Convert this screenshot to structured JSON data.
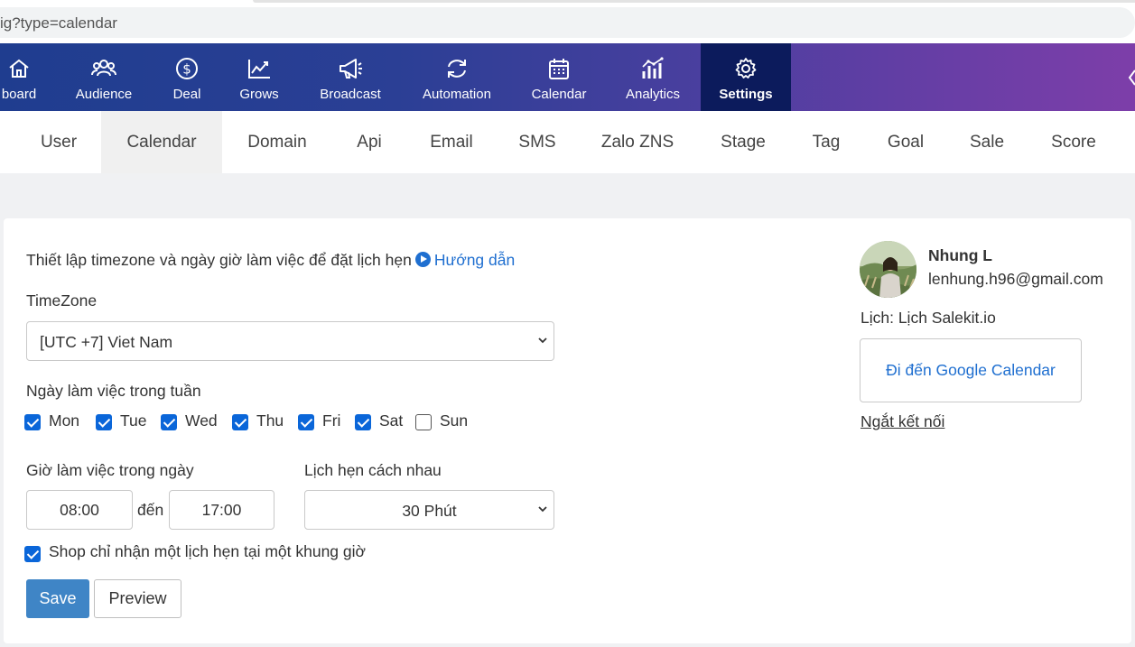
{
  "browser": {
    "url": "ig?type=calendar"
  },
  "topnav": {
    "items": [
      {
        "label": "board",
        "icon": "home-icon"
      },
      {
        "label": "Audience",
        "icon": "users-icon"
      },
      {
        "label": "Deal",
        "icon": "dollar-icon"
      },
      {
        "label": "Grows",
        "icon": "trend-icon"
      },
      {
        "label": "Broadcast",
        "icon": "megaphone-icon"
      },
      {
        "label": "Automation",
        "icon": "refresh-icon"
      },
      {
        "label": "Calendar",
        "icon": "calendar-icon"
      },
      {
        "label": "Analytics",
        "icon": "analytics-icon"
      },
      {
        "label": "Settings",
        "icon": "gear-icon"
      }
    ],
    "active": "Settings"
  },
  "subtabs": {
    "items": [
      "User",
      "Calendar",
      "Domain",
      "Api",
      "Email",
      "SMS",
      "Zalo ZNS",
      "Stage",
      "Tag",
      "Goal",
      "Sale",
      "Score"
    ],
    "active": "Calendar"
  },
  "form": {
    "intro": "Thiết lập timezone và ngày giờ làm việc để đặt lịch hẹn",
    "guide_link": "Hướng dẫn",
    "timezone_label": "TimeZone",
    "timezone_value": "[UTC +7] Viet Nam",
    "workdays_label": "Ngày làm việc trong tuần",
    "days": [
      {
        "label": "Mon",
        "checked": true
      },
      {
        "label": "Tue",
        "checked": true
      },
      {
        "label": "Wed",
        "checked": true
      },
      {
        "label": "Thu",
        "checked": true
      },
      {
        "label": "Fri",
        "checked": true
      },
      {
        "label": "Sat",
        "checked": true
      },
      {
        "label": "Sun",
        "checked": false
      }
    ],
    "hours_label": "Giờ làm việc trong ngày",
    "start_time": "08:00",
    "to_label": "đến",
    "end_time": "17:00",
    "interval_label": "Lịch hẹn cách nhau",
    "interval_value": "30 Phút",
    "single_slot_label": "Shop chỉ nhận một lịch hẹn tại một khung giờ",
    "single_slot_checked": true,
    "save_label": "Save",
    "preview_label": "Preview"
  },
  "account": {
    "name": "Nhung L",
    "email": "lenhung.h96@gmail.com",
    "calendar_text": "Lịch: Lịch Salekit.io",
    "google_button": "Đi đến Google Calendar",
    "disconnect_link": "Ngắt kết nối"
  },
  "colors": {
    "nav_gradient_start": "#1f3d8f",
    "nav_gradient_end": "#7d3ea9",
    "nav_active": "#0c1b5c",
    "link_blue": "#1f6fd0",
    "checkbox_blue": "#0a66d9",
    "save_button": "#3f85c6"
  }
}
